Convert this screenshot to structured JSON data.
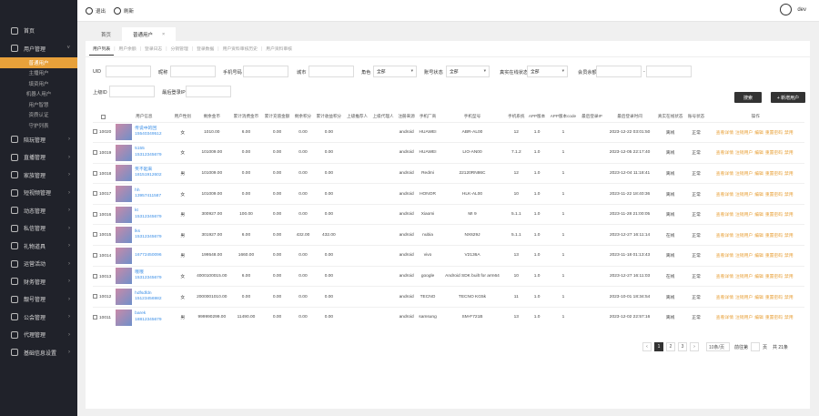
{
  "topbar": {
    "logout_label": "退出",
    "refresh_label": "刷新",
    "username": "dev"
  },
  "tabs": [
    {
      "label": "首页"
    },
    {
      "label": "普通用户",
      "close": "×"
    }
  ],
  "sidebar": {
    "items": [
      {
        "label": "首页",
        "icon": "home-icon"
      },
      {
        "label": "用户管理",
        "icon": "user-icon",
        "expanded": true
      },
      {
        "label": "陪玩管理",
        "icon": "gamepad-icon"
      },
      {
        "label": "直播管理",
        "icon": "video-icon"
      },
      {
        "label": "家族管理",
        "icon": "team-icon"
      },
      {
        "label": "短视频管理",
        "icon": "film-icon"
      },
      {
        "label": "动态管理",
        "icon": "dynamic-icon"
      },
      {
        "label": "私信管理",
        "icon": "message-icon"
      },
      {
        "label": "礼物道具",
        "icon": "gift-icon"
      },
      {
        "label": "运营活动",
        "icon": "activity-icon"
      },
      {
        "label": "财务管理",
        "icon": "finance-icon"
      },
      {
        "label": "靓号管理",
        "icon": "number-icon"
      },
      {
        "label": "公会管理",
        "icon": "guild-icon"
      },
      {
        "label": "代理管理",
        "icon": "agent-icon"
      },
      {
        "label": "基础信息设置",
        "icon": "settings-icon"
      }
    ],
    "subitems": [
      "普通用户",
      "主播用户",
      "填资用户",
      "机器人用户",
      "用户智慧",
      "资质认证",
      "守护列表"
    ]
  },
  "subnav": [
    "用户列表",
    "用户余额",
    "登录日志",
    "分销管理",
    "登录数据",
    "用户资料审核历史",
    "用户资料审核"
  ],
  "filters": {
    "uid": "UID",
    "nickname": "昵称",
    "phone": "手机号码",
    "region": "城市",
    "role": "角色",
    "role_value": "全部",
    "account_status": "账号状态",
    "account_status_value": "全部",
    "online_status": "真实在线状态",
    "online_status_value": "全部",
    "reg_time": "会员余额",
    "range_sep": "-",
    "parent_id": "上级ID",
    "last_ip": "最后登录IP",
    "search_label": "搜索",
    "add_label": "+ 新增用户"
  },
  "table": {
    "columns": [
      "",
      "用户信息",
      "用户性别",
      "剩余金币",
      "累计消费金币",
      "累计充值金额",
      "剩余积分",
      "累计收益积分",
      "上级推荐人",
      "上级代理人",
      "注册来源",
      "手机厂商",
      "手机型号",
      "手机系统",
      "APP版本",
      "APP版本code",
      "最后登录IP",
      "最后登录时间",
      "真实在线状态",
      "账号状态",
      "操作"
    ],
    "rows": [
      {
        "uid": "10020",
        "name": "传说中的回",
        "phone": "15540349512",
        "gender": "女",
        "coins": "1010.00",
        "spent": "6.00",
        "recharge": "0.00",
        "points": "0.00",
        "earned": "0.00",
        "ref": "",
        "agent": "",
        "src": "android",
        "maker": "HUAWEI",
        "model": "ABR-AL00",
        "os": "12",
        "app": "1.0",
        "code": "1",
        "ip": "",
        "time": "2023-12-22 03:01:50",
        "online": "离线",
        "status": "正常"
      },
      {
        "uid": "10019",
        "name": "5155",
        "phone": "15312345679",
        "gender": "女",
        "coins": "101009.00",
        "spent": "0.00",
        "recharge": "0.00",
        "points": "0.00",
        "earned": "0.00",
        "ref": "",
        "agent": "",
        "src": "android",
        "maker": "HUAWEI",
        "model": "LIO-AN00",
        "os": "7.1.2",
        "app": "1.0",
        "code": "1",
        "ip": "",
        "time": "2023-12-05 22:17:40",
        "online": "离线",
        "status": "正常"
      },
      {
        "uid": "10018",
        "name": "笑不起来",
        "phone": "18151912602",
        "gender": "男",
        "coins": "101009.00",
        "spent": "0.00",
        "recharge": "0.00",
        "points": "0.00",
        "earned": "0.00",
        "ref": "",
        "agent": "",
        "src": "android",
        "maker": "Redmi",
        "model": "22120RN86C",
        "os": "12",
        "app": "1.0",
        "code": "1",
        "ip": "",
        "time": "2023-12-04 11:18:41",
        "online": "离线",
        "status": "正常"
      },
      {
        "uid": "10017",
        "name": "hh",
        "phone": "13957411587",
        "gender": "女",
        "coins": "101009.00",
        "spent": "0.00",
        "recharge": "0.00",
        "points": "0.00",
        "earned": "0.00",
        "ref": "",
        "agent": "",
        "src": "android",
        "maker": "HONOR",
        "model": "HLK-AL00",
        "os": "10",
        "app": "1.0",
        "code": "1",
        "ip": "",
        "time": "2023-11-22 18:40:36",
        "online": "离线",
        "status": "正常"
      },
      {
        "uid": "10016",
        "name": "kt",
        "phone": "15312345679",
        "gender": "男",
        "coins": "300927.00",
        "spent": "100.00",
        "recharge": "0.00",
        "points": "0.00",
        "earned": "0.00",
        "ref": "",
        "agent": "",
        "src": "android",
        "maker": "Xiaomi",
        "model": "MI 9",
        "os": "5.1.1",
        "app": "1.0",
        "code": "1",
        "ip": "",
        "time": "2023-11-28 21:00:05",
        "online": "离线",
        "status": "正常"
      },
      {
        "uid": "10015",
        "name": "lks",
        "phone": "15312345679",
        "gender": "男",
        "coins": "301927.00",
        "spent": "6.00",
        "recharge": "0.00",
        "points": "432.00",
        "earned": "432.00",
        "ref": "",
        "agent": "",
        "src": "android",
        "maker": "nubia",
        "model": "NX629J",
        "os": "5.1.1",
        "app": "1.0",
        "code": "1",
        "ip": "",
        "time": "2023-12-27 16:11:14",
        "online": "在线",
        "status": "正常"
      },
      {
        "uid": "10014",
        "name": "",
        "phone": "16772450096",
        "gender": "男",
        "coins": "199548.00",
        "spent": "1660.00",
        "recharge": "0.00",
        "points": "0.00",
        "earned": "0.00",
        "ref": "",
        "agent": "",
        "src": "android",
        "maker": "vivo",
        "model": "V2136A",
        "os": "13",
        "app": "1.0",
        "code": "1",
        "ip": "",
        "time": "2023-11-18 01:13:43",
        "online": "离线",
        "status": "正常"
      },
      {
        "uid": "10013",
        "name": "哦哦",
        "phone": "15312345679",
        "gender": "女",
        "coins": "4000100015.00",
        "spent": "6.00",
        "recharge": "0.00",
        "points": "0.00",
        "earned": "0.00",
        "ref": "",
        "agent": "",
        "src": "android",
        "maker": "google",
        "model": "Android SDK built for arm64",
        "os": "10",
        "app": "1.0",
        "code": "1",
        "ip": "",
        "time": "2023-12-27 16:11:03",
        "online": "在线",
        "status": "正常"
      },
      {
        "uid": "10012",
        "name": "hdfsdfdn",
        "phone": "15123456982",
        "gender": "女",
        "coins": "2000001010.00",
        "spent": "0.00",
        "recharge": "0.00",
        "points": "0.00",
        "earned": "0.00",
        "ref": "",
        "agent": "",
        "src": "android",
        "maker": "TECNO",
        "model": "TECNO KG5k",
        "os": "11",
        "app": "1.0",
        "code": "1",
        "ip": "",
        "time": "2023-10-01 18:34:54",
        "online": "离线",
        "status": "正常"
      },
      {
        "uid": "10011",
        "name": "barek",
        "phone": "18812345679",
        "gender": "男",
        "coins": "999990299.00",
        "spent": "11490.00",
        "recharge": "0.00",
        "points": "0.00",
        "earned": "0.00",
        "ref": "",
        "agent": "",
        "src": "android",
        "maker": "samsung",
        "model": "SM-F721B",
        "os": "13",
        "app": "1.0",
        "code": "1",
        "ip": "",
        "time": "2023-12-02 22:57:16",
        "online": "离线",
        "status": "正常"
      }
    ],
    "ops": [
      "查看详情",
      "注销用户",
      "编辑",
      "重置密码",
      "禁用"
    ]
  },
  "pager": {
    "prev": "‹",
    "pages": [
      "1",
      "2",
      "3"
    ],
    "next": "›",
    "per_page": "10条/页",
    "goto": "前往第",
    "page_unit": "页",
    "go_button": "确定",
    "total": "共 21条"
  },
  "watermark": "https://www.huzhan.com/ishop28145"
}
